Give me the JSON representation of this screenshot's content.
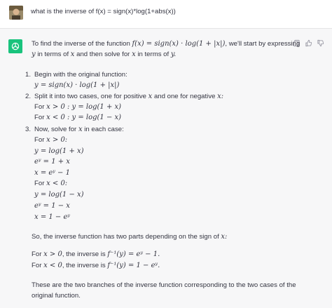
{
  "user": {
    "avatar_icon": "user-avatar",
    "message": "what is the inverse of f(x) = sign(x)*log(1+abs(x))"
  },
  "assistant": {
    "logo_icon": "chatgpt-logo-icon",
    "actions": [
      "copy-icon",
      "thumbs-up-icon",
      "thumbs-down-icon"
    ],
    "intro_a": "To find the inverse of the function",
    "intro_math": "f(x) = sign(x) · log(1 + |x|)",
    "intro_b": ", we'll start by expressing",
    "intro2_a": "y",
    "intro2_b": "in terms of",
    "intro2_c": "x",
    "intro2_d": "and then solve for",
    "intro2_e": "x",
    "intro2_f": "in terms of",
    "intro2_g": "y.",
    "steps": [
      {
        "num": "1.",
        "text": "Begin with the original function:",
        "lines": [
          "y = sign(x) · log(1 + |x|)"
        ]
      },
      {
        "num": "2.",
        "text_a": "Split it into two cases, one for positive",
        "text_m": "x",
        "text_b": "and one for negative",
        "text_m2": "x:",
        "lines": [
          {
            "label": "For",
            "math": "x > 0 : y = log(1 + x)"
          },
          {
            "label": "For",
            "math": "x < 0 : y = log(1 − x)"
          }
        ]
      },
      {
        "num": "3.",
        "text_a": "Now, solve for",
        "text_m": "x",
        "text_b": "in each case:",
        "case1_label": "For",
        "case1_cond": "x > 0:",
        "case1_lines": [
          "y = log(1 + x)",
          "eʸ = 1 + x",
          "x = eʸ − 1"
        ],
        "case2_label": "For",
        "case2_cond": "x < 0:",
        "case2_lines": [
          "y = log(1 − x)",
          "eʸ = 1 − x",
          "x = 1 − eʸ"
        ]
      }
    ],
    "summary_a": "So, the inverse function has two parts depending on the sign of",
    "summary_m": "x:",
    "inv1_a": "For",
    "inv1_m1": "x > 0",
    "inv1_b": ", the inverse is",
    "inv1_m2": "f⁻¹(y) = eʸ − 1.",
    "inv2_a": "For",
    "inv2_m1": "x < 0",
    "inv2_b": ", the inverse is",
    "inv2_m2": "f⁻¹(y) = 1 − eʸ.",
    "closing1": "These are the two branches of the inverse function corresponding to the two cases of the",
    "closing2": "original function."
  }
}
